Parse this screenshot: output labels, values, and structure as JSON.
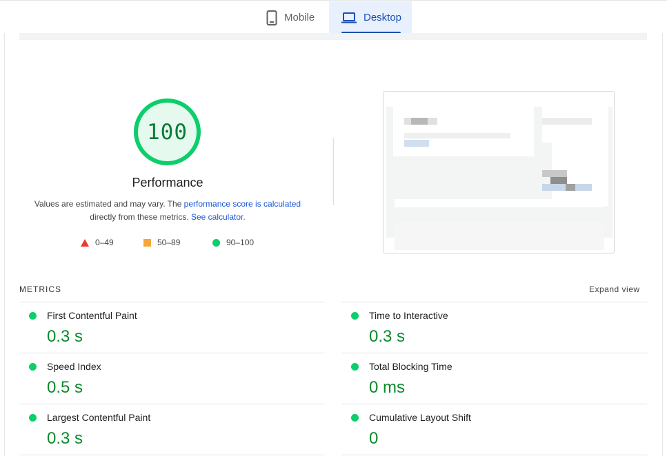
{
  "tabs": {
    "mobile_label": "Mobile",
    "desktop_label": "Desktop",
    "active": "Desktop"
  },
  "score": {
    "value": "100",
    "category": "Performance",
    "desc_prefix": "Values are estimated and may vary. The ",
    "desc_link1": "performance score is calculated",
    "desc_middle": " directly from these metrics. ",
    "desc_link2": "See calculator.",
    "status_color": "#0cce6b"
  },
  "legend": {
    "fail": "0–49",
    "average": "50–89",
    "pass": "90–100"
  },
  "metrics": {
    "section_label": "METRICS",
    "expand_label": "Expand view",
    "items": [
      {
        "name": "First Contentful Paint",
        "value": "0.3 s"
      },
      {
        "name": "Time to Interactive",
        "value": "0.3 s"
      },
      {
        "name": "Speed Index",
        "value": "0.5 s"
      },
      {
        "name": "Total Blocking Time",
        "value": "0 ms"
      },
      {
        "name": "Largest Contentful Paint",
        "value": "0.3 s"
      },
      {
        "name": "Cumulative Layout Shift",
        "value": "0"
      }
    ]
  }
}
